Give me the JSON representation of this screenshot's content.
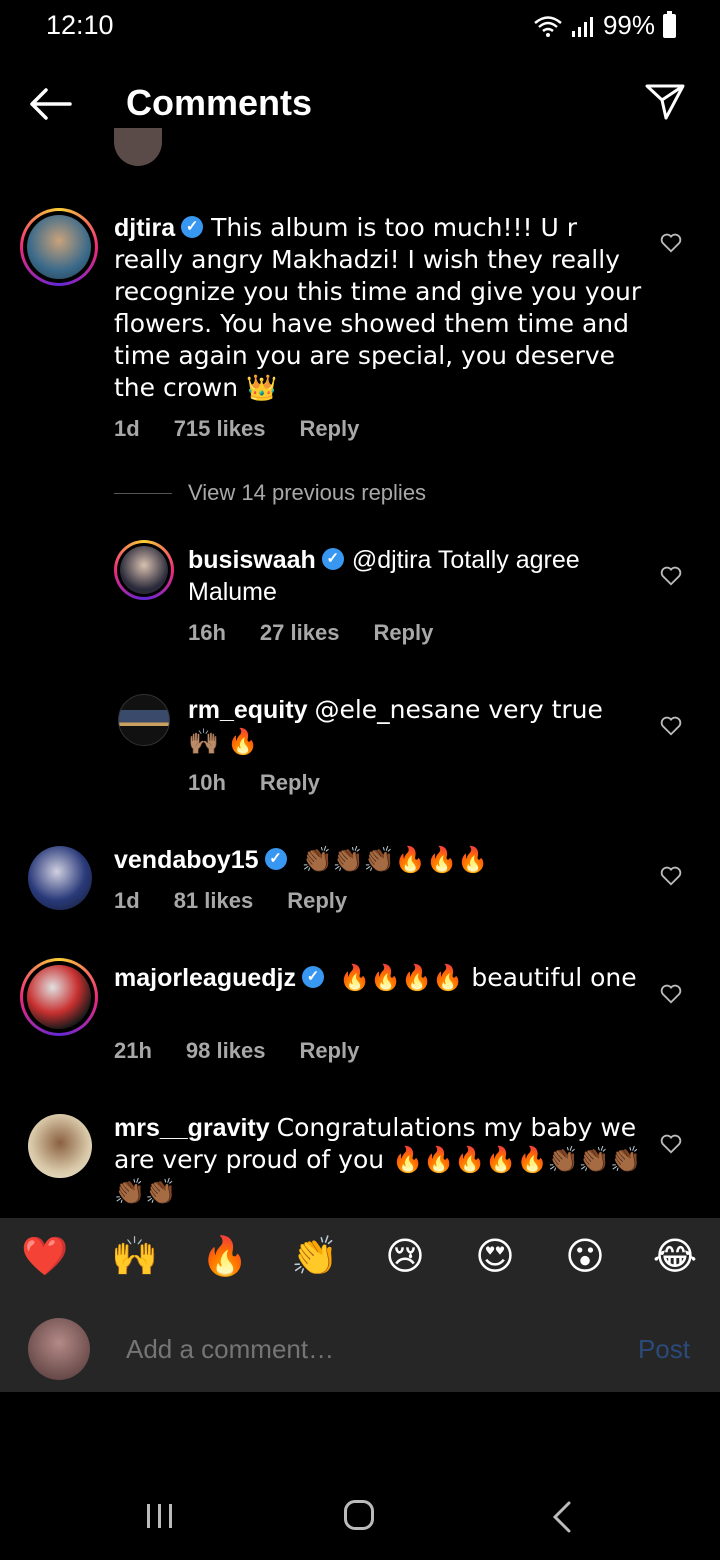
{
  "status": {
    "time": "12:10",
    "battery": "99%"
  },
  "header": {
    "title": "Comments"
  },
  "comments": [
    {
      "user": "djtira",
      "verified": true,
      "text": "This album is too much!!! U r really angry Makhadzi! I wish they really recognize you this time and give you your flowers. You have showed them time and time again you are special, you deserve the crown 👑",
      "time": "1d",
      "likes": "715 likes",
      "reply": "Reply"
    },
    {
      "user": "vendaboy15",
      "verified": true,
      "text": "👏🏾👏🏾👏🏾🔥🔥🔥",
      "time": "1d",
      "likes": "81 likes",
      "reply": "Reply"
    },
    {
      "user": "majorleaguedjz",
      "verified": true,
      "text": "🔥🔥🔥🔥 beautiful one",
      "time": "21h",
      "likes": "98 likes",
      "reply": "Reply"
    },
    {
      "user": "mrs__gravity",
      "verified": false,
      "text": "Congratulations my baby we are very proud of you 🔥🔥🔥🔥🔥👏🏾👏🏾👏🏾👏🏾👏🏾",
      "time": "",
      "likes": "",
      "reply": ""
    }
  ],
  "view_replies": "View 14 previous replies",
  "replies": [
    {
      "user": "busiswaah",
      "verified": true,
      "text": "@djtira Totally agree Malume",
      "time": "16h",
      "likes": "27 likes",
      "reply": "Reply"
    },
    {
      "user": "rm_equity",
      "verified": false,
      "text": "@ele_nesane very true 🙌🏽 🔥",
      "time": "10h",
      "reply": "Reply"
    }
  ],
  "reactions": [
    "❤️",
    "🙌",
    "🔥",
    "👏",
    "😢",
    "😍",
    "😮",
    "😂"
  ],
  "composer": {
    "placeholder": "Add a comment…",
    "post": "Post"
  }
}
